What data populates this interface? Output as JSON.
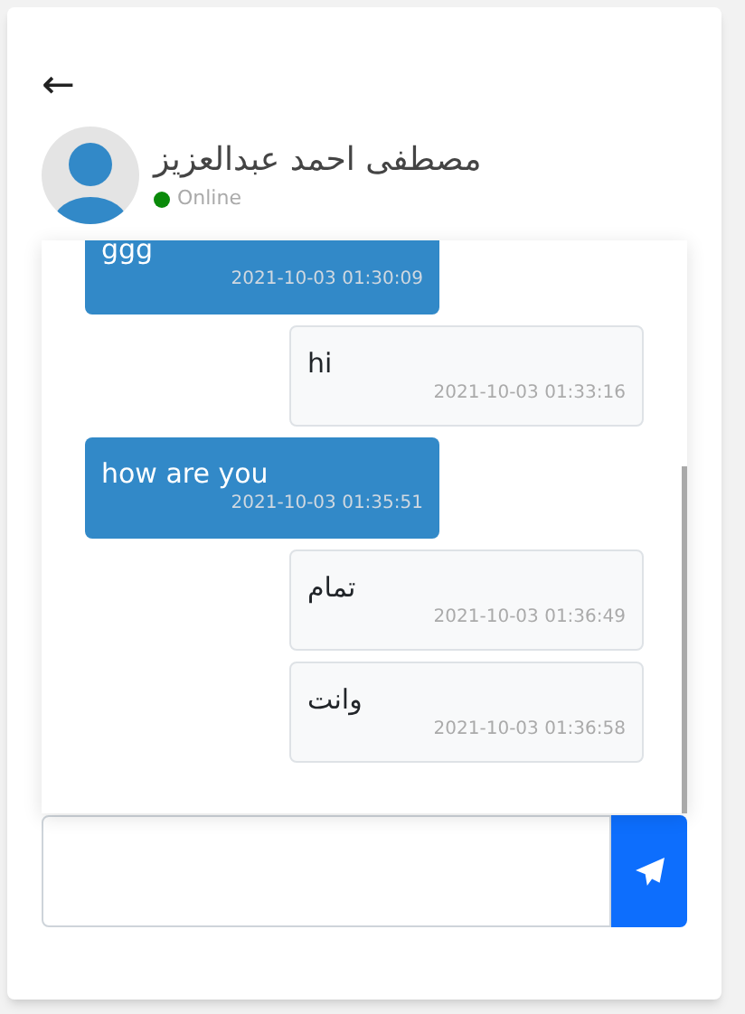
{
  "header": {
    "back": "←",
    "contact_name": "مصطفى احمد عبدالعزيز",
    "status": "Online",
    "online": true
  },
  "messages": [
    {
      "kind": "sent",
      "text": "ggg",
      "time": "2021-10-03 01:30:09"
    },
    {
      "kind": "received",
      "text": "hi",
      "time": "2021-10-03 01:33:16"
    },
    {
      "kind": "sent",
      "text": "how are you",
      "time": "2021-10-03 01:35:51"
    },
    {
      "kind": "received",
      "text": "تمام",
      "time": "2021-10-03 01:36:49"
    },
    {
      "kind": "received",
      "text": "وانت",
      "time": "2021-10-03 01:36:58"
    }
  ]
}
